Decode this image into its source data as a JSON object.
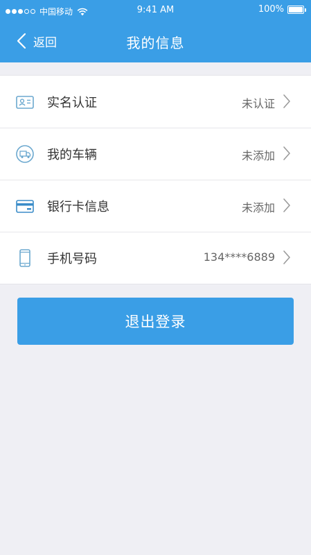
{
  "status_bar": {
    "carrier": "中国移动",
    "time": "9:41 AM",
    "battery": "100%",
    "signal_bars_filled": 3,
    "signal_bars_total": 5
  },
  "navbar": {
    "back_label": "返回",
    "title": "我的信息"
  },
  "rows": [
    {
      "label": "实名认证",
      "value": "未认证",
      "icon": "id-card-icon"
    },
    {
      "label": "我的车辆",
      "value": "未添加",
      "icon": "vehicle-icon"
    },
    {
      "label": "银行卡信息",
      "value": "未添加",
      "icon": "bank-card-icon"
    },
    {
      "label": "手机号码",
      "value": "134****6889",
      "icon": "phone-icon"
    }
  ],
  "logout_label": "退出登录",
  "colors": {
    "accent": "#3a9ee6",
    "background": "#efeff4",
    "icon": "#6ba8cf"
  }
}
